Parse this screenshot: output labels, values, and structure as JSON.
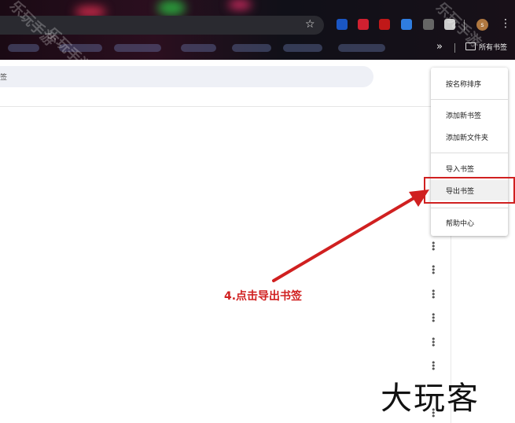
{
  "browser": {
    "star_glyph": "☆",
    "ext_colors": [
      "#1a56c4",
      "#d02030",
      "#c01818",
      "#2f7de0",
      "#666666",
      "#cccccc"
    ],
    "avatar_letter": "s",
    "kebab_glyph": "⋮",
    "bookmark_overflow": "»",
    "all_bookmarks": "所有书签"
  },
  "watermark": "乐玩手游",
  "search": {
    "placeholder_tail": "签"
  },
  "menu": {
    "items": [
      "按名称排序",
      "添加新书签",
      "添加新文件夹",
      "导入书签",
      "导出书签",
      "帮助中心"
    ]
  },
  "annotation": {
    "text": "4.点击导出书签",
    "color": "#d02020"
  },
  "logo": "大玩客"
}
